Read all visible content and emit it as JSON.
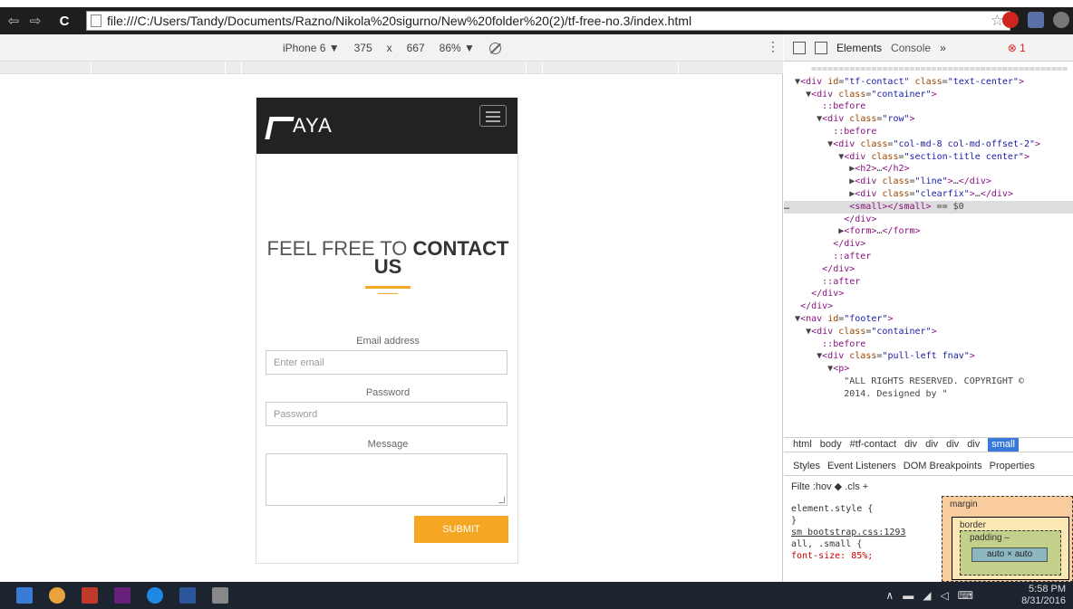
{
  "browser": {
    "url": "file:///C:/Users/Tandy/Documents/Razno/Nikola%20sigurno/New%20folder%20(2)/tf-free-no.3/index.html"
  },
  "device_toolbar": {
    "device": "iPhone 6 ▼",
    "width": "375",
    "x": "x",
    "height": "667",
    "zoom": "86% ▼"
  },
  "site": {
    "logo_text": "AYA",
    "title_light": "FEEL FREE TO",
    "title_bold": "CONTACT",
    "title_bold2": "US",
    "email_label": "Email address",
    "email_placeholder": "Enter email",
    "password_label": "Password",
    "password_placeholder": "Password",
    "message_label": "Message",
    "submit_label": "SUBMIT"
  },
  "devtools": {
    "tab_elements": "Elements",
    "tab_console": "Console",
    "tab_more": "»",
    "error_count": "1",
    "crumbs": [
      "html",
      "body",
      "#tf-contact",
      "div",
      "div",
      "div",
      "div",
      "small"
    ],
    "styles_tabs": [
      "Styles",
      "Event Listeners",
      "DOM Breakpoints",
      "Properties"
    ],
    "filter": "Filte :hov  ◆  .cls  +",
    "rules": [
      "element.style {",
      "}",
      "sm bootstrap.css:1293",
      "all, .small {",
      "  font-size: 85%;"
    ],
    "box_margin": "margin",
    "box_border": "border",
    "box_padding": "padding –",
    "box_content": "auto × auto"
  },
  "taskbar": {
    "time": "5:58 PM",
    "date": "8/31/2016"
  }
}
